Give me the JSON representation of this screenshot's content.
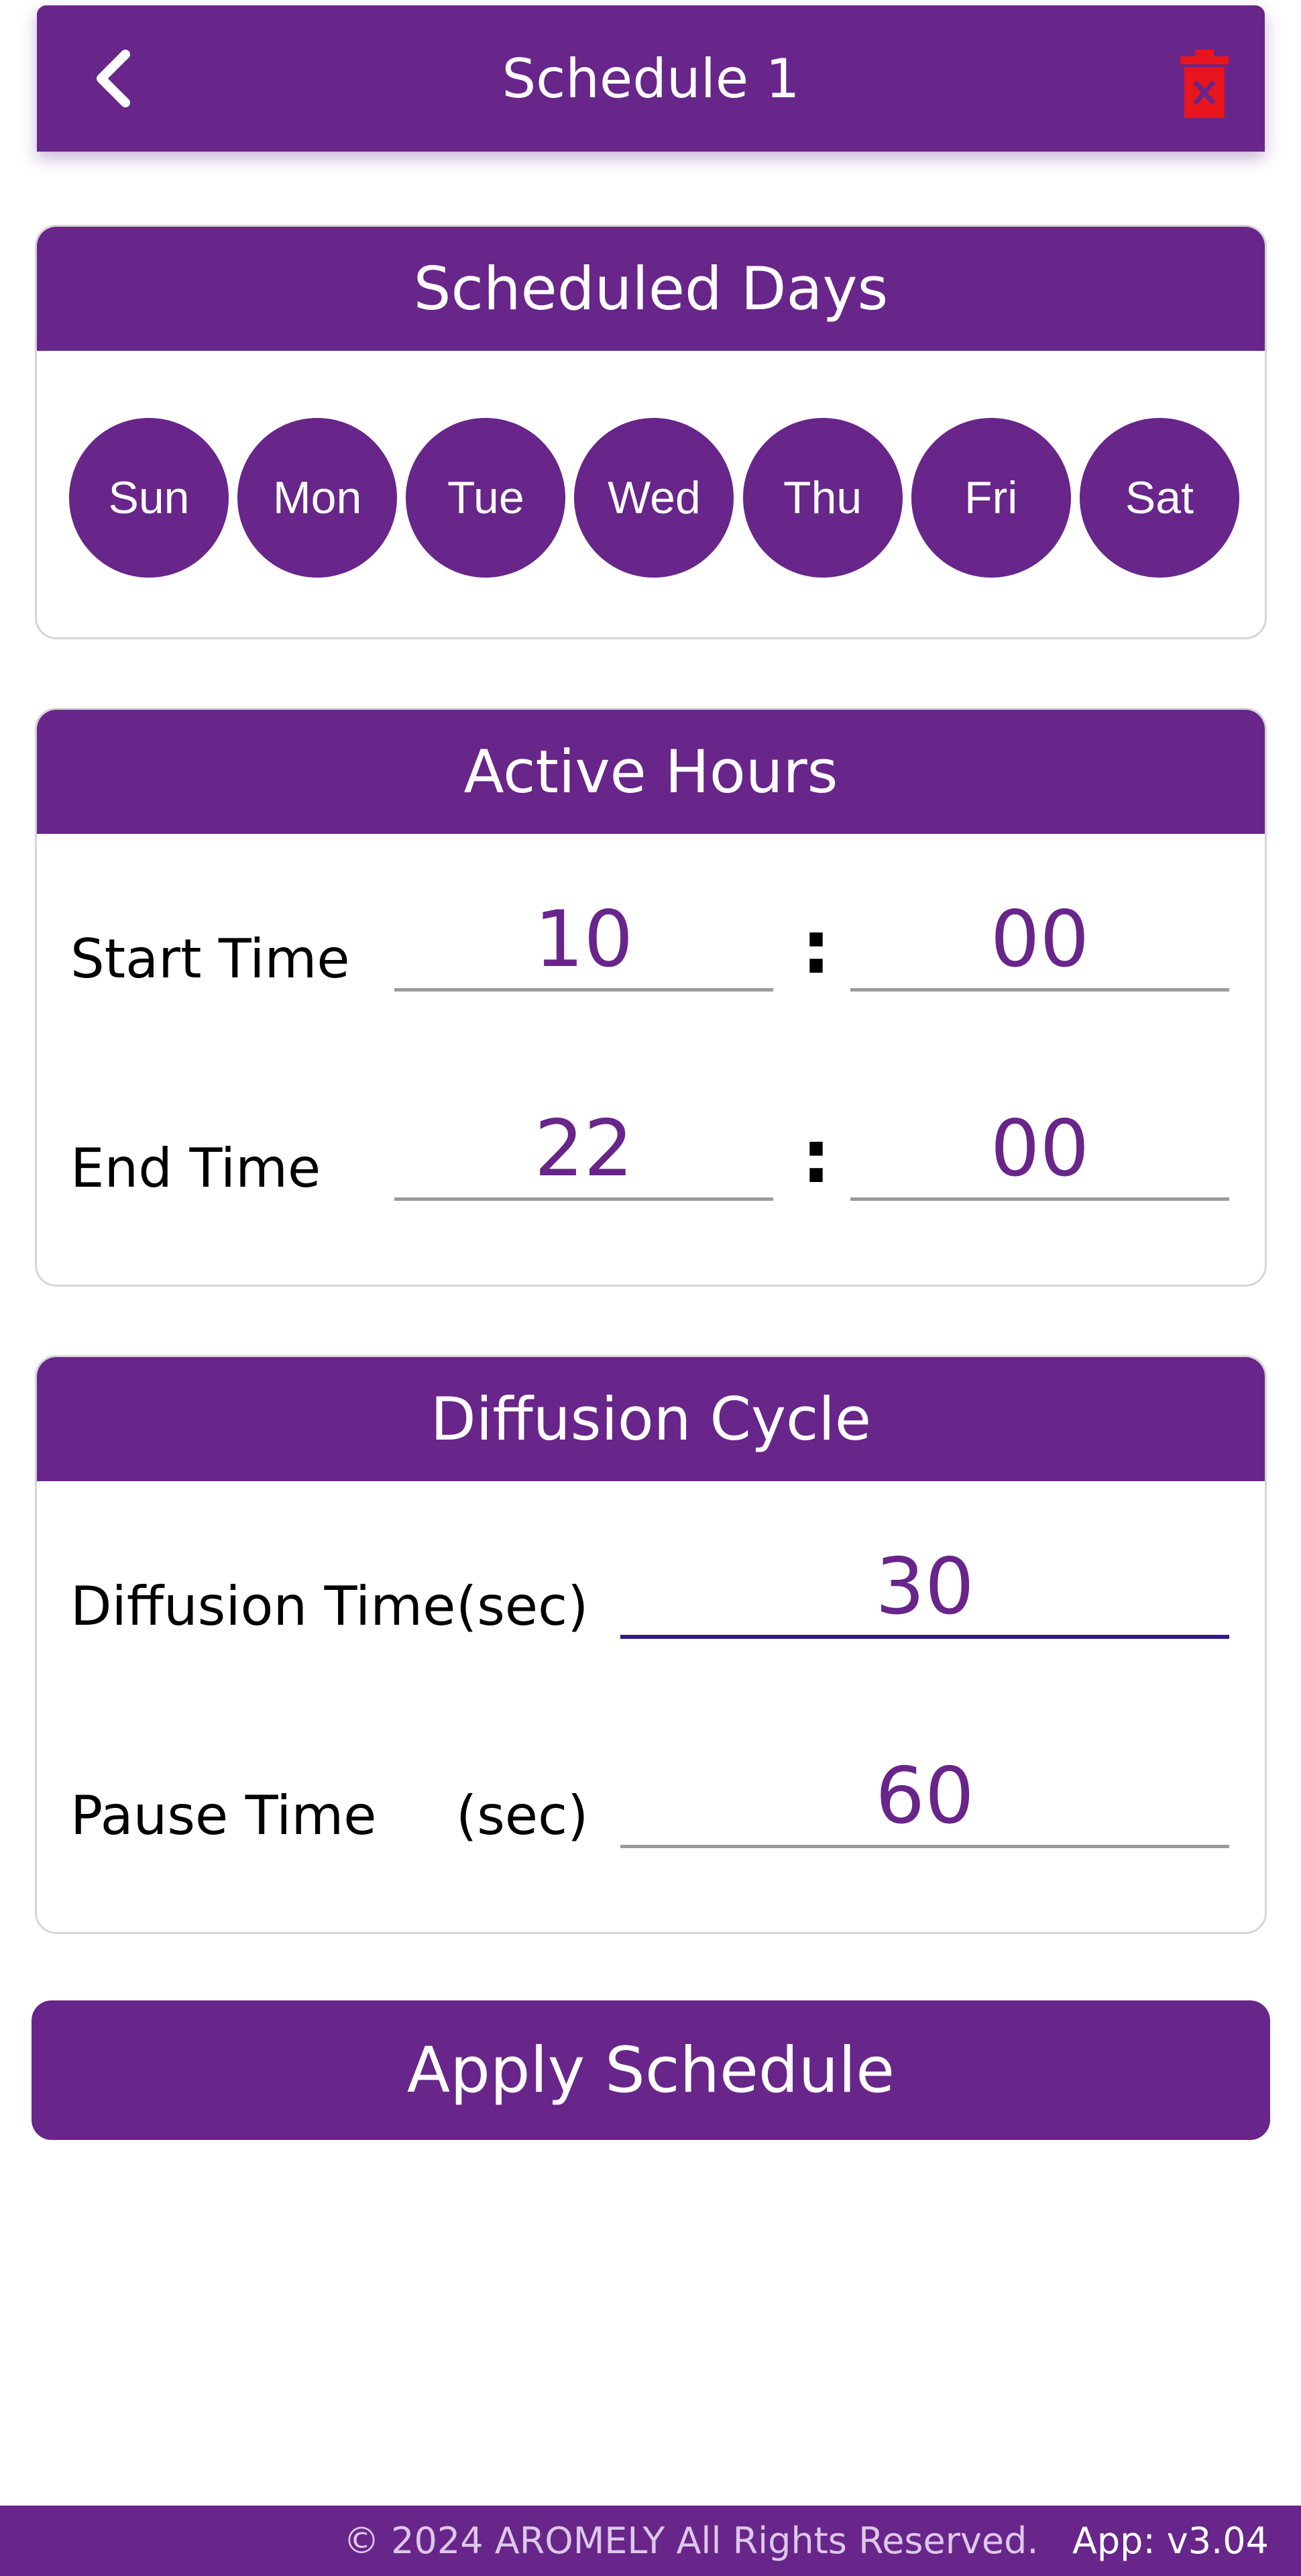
{
  "header": {
    "title": "Schedule 1",
    "back_icon": "chevron-left-icon",
    "delete_icon": "trash-icon"
  },
  "colors": {
    "primary": "#68258a",
    "delete": "#e8141e",
    "focus_underline": "#2f1a8a"
  },
  "scheduled_days": {
    "title": "Scheduled Days",
    "days": [
      "Sun",
      "Mon",
      "Tue",
      "Wed",
      "Thu",
      "Fri",
      "Sat"
    ]
  },
  "active_hours": {
    "title": "Active Hours",
    "start_label": "Start Time",
    "start_hour": "10",
    "start_minute": "00",
    "end_label": "End Time",
    "end_hour": "22",
    "end_minute": "00",
    "separator": ":"
  },
  "diffusion_cycle": {
    "title": "Diffusion Cycle",
    "diffusion_label": "Diffusion Time",
    "diffusion_unit": "(sec)",
    "diffusion_value": "30",
    "pause_label": "Pause Time",
    "pause_unit": "(sec)",
    "pause_value": "60"
  },
  "apply_button": "Apply Schedule",
  "footer": {
    "copyright": "© 2024 AROMELY All Rights Reserved.",
    "version": "App: v3.04"
  }
}
